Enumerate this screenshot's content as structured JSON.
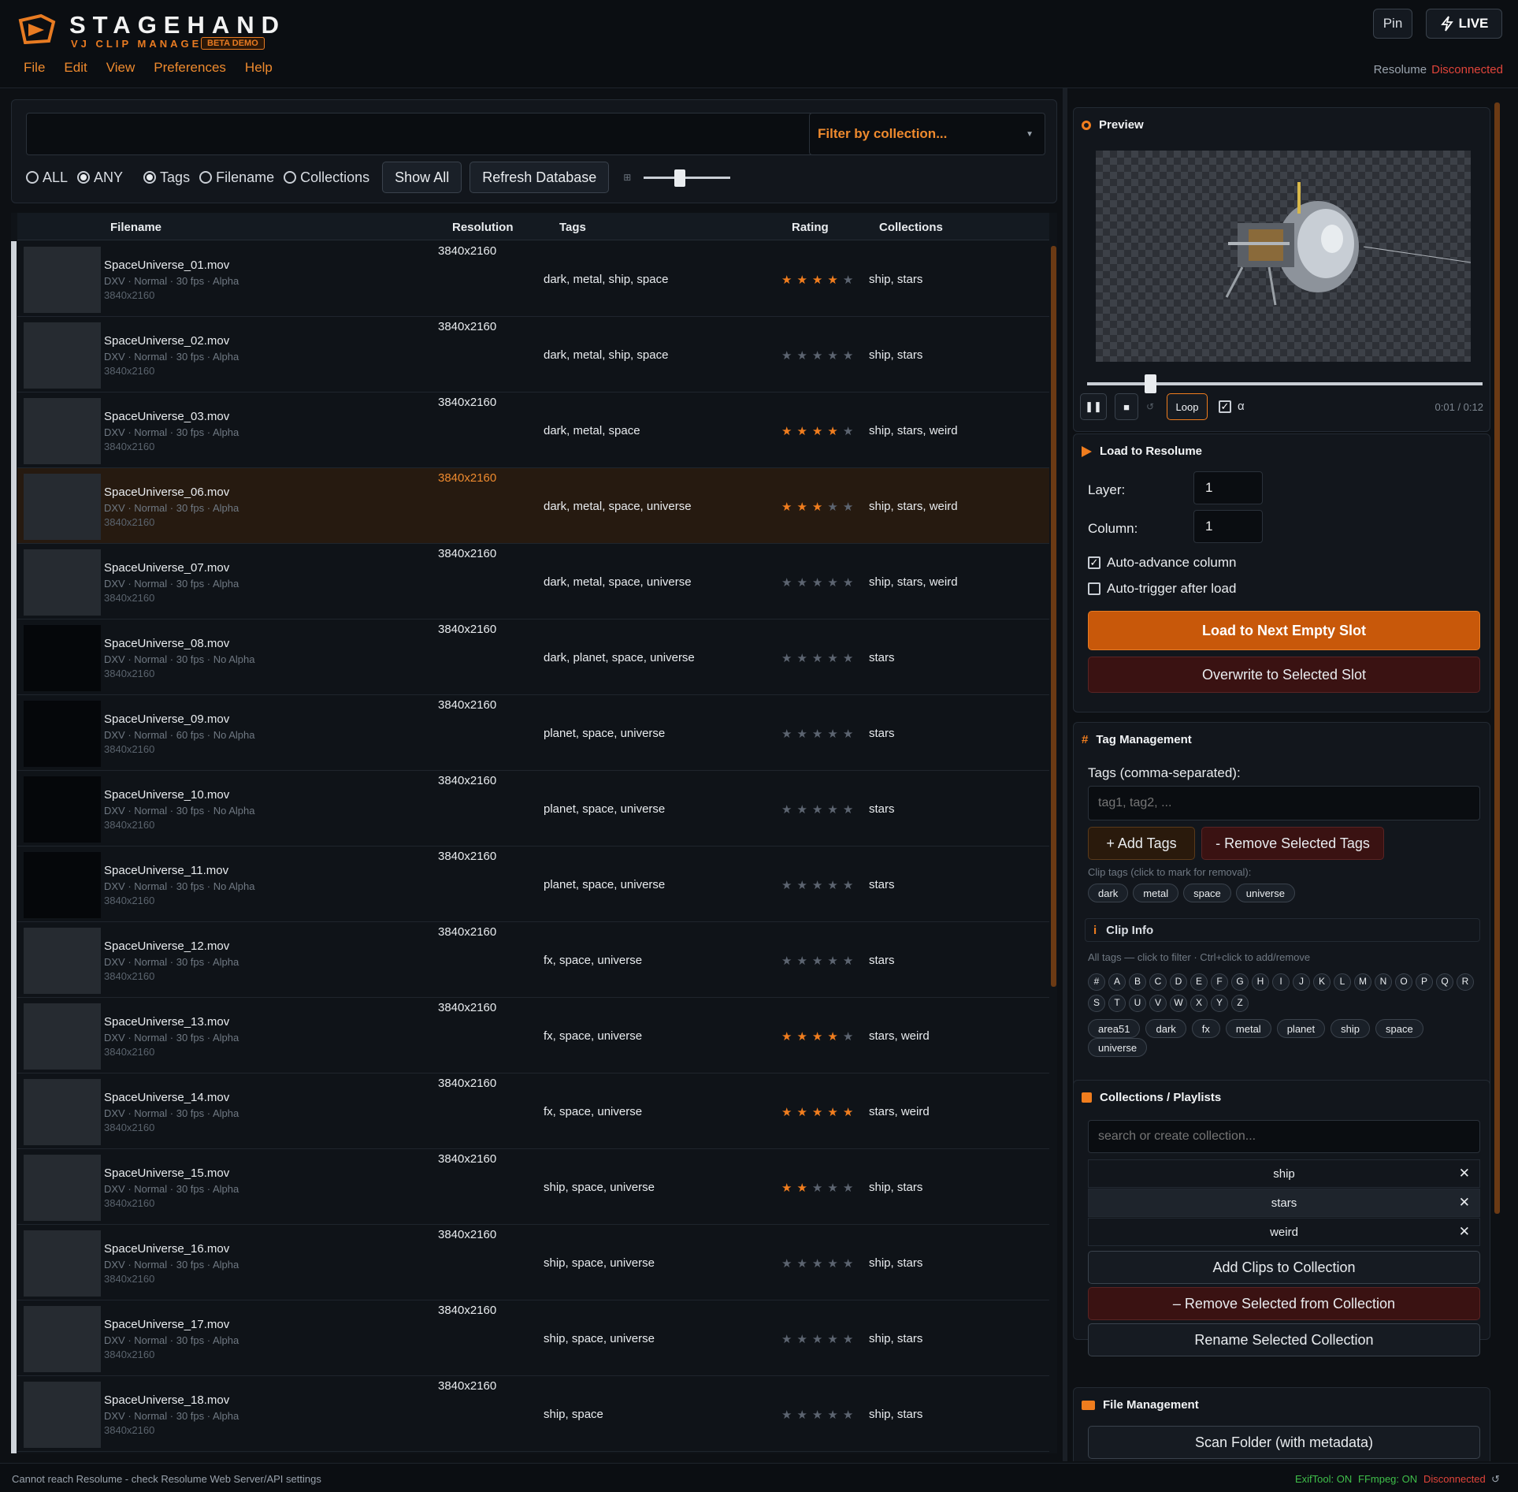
{
  "app": {
    "title": "STAGEHAND",
    "subtitle": "VJ CLIP MANAGER",
    "badge": "BETA DEMO"
  },
  "menu": [
    "File",
    "Edit",
    "View",
    "Preferences",
    "Help"
  ],
  "header": {
    "pin_label": "Pin",
    "live_label": "LIVE",
    "resolume_label": "Resolume",
    "resolume_status": "Disconnected",
    "status_color": "#e0443a"
  },
  "search": {
    "query": "",
    "collection_filter": "Filter by collection...",
    "match_options": [
      "ALL",
      "ANY"
    ],
    "match_selected": "ANY",
    "field_options": [
      "Tags",
      "Filename",
      "Collections"
    ],
    "field_selected": "Tags",
    "show_all_label": "Show All",
    "refresh_label": "Refresh Database",
    "thumb_size": 0.4
  },
  "table": {
    "columns": [
      "Filename",
      "Resolution",
      "Tags",
      "Rating",
      "Collections"
    ],
    "rows": [
      {
        "filename": "SpaceUniverse_01.mov",
        "meta": "DXV · Normal · 30 fps · Alpha",
        "res": "3840x2160",
        "tags": "dark, metal, ship, space",
        "rating": 4,
        "collections": "ship, stars",
        "dark": false
      },
      {
        "filename": "SpaceUniverse_02.mov",
        "meta": "DXV · Normal · 30 fps · Alpha",
        "res": "3840x2160",
        "tags": "dark, metal, ship, space",
        "rating": 0,
        "collections": "ship, stars",
        "dark": false
      },
      {
        "filename": "SpaceUniverse_03.mov",
        "meta": "DXV · Normal · 30 fps · Alpha",
        "res": "3840x2160",
        "tags": "dark, metal, space",
        "rating": 4,
        "collections": "ship, stars, weird",
        "dark": false
      },
      {
        "filename": "SpaceUniverse_06.mov",
        "meta": "DXV · Normal · 30 fps · Alpha",
        "res": "3840x2160",
        "tags": "dark, metal, space, universe",
        "rating": 3,
        "collections": "ship, stars, weird",
        "dark": false,
        "selected": true
      },
      {
        "filename": "SpaceUniverse_07.mov",
        "meta": "DXV · Normal · 30 fps · Alpha",
        "res": "3840x2160",
        "tags": "dark, metal, space, universe",
        "rating": 0,
        "collections": "ship, stars, weird",
        "dark": false
      },
      {
        "filename": "SpaceUniverse_08.mov",
        "meta": "DXV · Normal · 30 fps · No Alpha",
        "res": "3840x2160",
        "tags": "dark, planet, space, universe",
        "rating": 0,
        "collections": "stars",
        "dark": true
      },
      {
        "filename": "SpaceUniverse_09.mov",
        "meta": "DXV · Normal · 60 fps · No Alpha",
        "res": "3840x2160",
        "tags": "planet, space, universe",
        "rating": 0,
        "collections": "stars",
        "dark": true
      },
      {
        "filename": "SpaceUniverse_10.mov",
        "meta": "DXV · Normal · 30 fps · No Alpha",
        "res": "3840x2160",
        "tags": "planet, space, universe",
        "rating": 0,
        "collections": "stars",
        "dark": true
      },
      {
        "filename": "SpaceUniverse_11.mov",
        "meta": "DXV · Normal · 30 fps · No Alpha",
        "res": "3840x2160",
        "tags": "planet, space, universe",
        "rating": 0,
        "collections": "stars",
        "dark": true
      },
      {
        "filename": "SpaceUniverse_12.mov",
        "meta": "DXV · Normal · 30 fps · Alpha",
        "res": "3840x2160",
        "tags": "fx, space, universe",
        "rating": 0,
        "collections": "stars",
        "dark": false
      },
      {
        "filename": "SpaceUniverse_13.mov",
        "meta": "DXV · Normal · 30 fps · Alpha",
        "res": "3840x2160",
        "tags": "fx, space, universe",
        "rating": 4,
        "collections": "stars, weird",
        "dark": false
      },
      {
        "filename": "SpaceUniverse_14.mov",
        "meta": "DXV · Normal · 30 fps · Alpha",
        "res": "3840x2160",
        "tags": "fx, space, universe",
        "rating": 5,
        "collections": "stars, weird",
        "dark": false
      },
      {
        "filename": "SpaceUniverse_15.mov",
        "meta": "DXV · Normal · 30 fps · Alpha",
        "res": "3840x2160",
        "tags": "ship, space, universe",
        "rating": 2,
        "collections": "ship, stars",
        "dark": false
      },
      {
        "filename": "SpaceUniverse_16.mov",
        "meta": "DXV · Normal · 30 fps · Alpha",
        "res": "3840x2160",
        "tags": "ship, space, universe",
        "rating": 0,
        "collections": "ship, stars",
        "dark": false
      },
      {
        "filename": "SpaceUniverse_17.mov",
        "meta": "DXV · Normal · 30 fps · Alpha",
        "res": "3840x2160",
        "tags": "ship, space, universe",
        "rating": 0,
        "collections": "ship, stars",
        "dark": false
      },
      {
        "filename": "SpaceUniverse_18.mov",
        "meta": "DXV · Normal · 30 fps · Alpha",
        "res": "3840x2160",
        "tags": "ship, space",
        "rating": 0,
        "collections": "ship, stars",
        "dark": false
      }
    ]
  },
  "preview": {
    "title": "Preview",
    "loop_label": "Loop",
    "alpha_label": "α",
    "time": "0:01 / 0:12",
    "position": 0.15
  },
  "load": {
    "title": "Load to Resolume",
    "layer_label": "Layer:",
    "layer": "1",
    "column_label": "Column:",
    "column": "1",
    "auto_advance": "Auto-advance column",
    "auto_trigger": "Auto-trigger after load",
    "load_next": "Load to Next Empty Slot",
    "overwrite": "Overwrite to Selected Slot"
  },
  "tags": {
    "title": "Tag Management",
    "input_label": "Tags (comma-separated):",
    "placeholder": "tag1, tag2, ...",
    "add_label": "+ Add Tags",
    "remove_label": "- Remove Selected Tags",
    "clip_tags_note": "Clip tags (click to mark for removal):",
    "clip_tags": [
      "dark",
      "metal",
      "space",
      "universe"
    ]
  },
  "clip_info": {
    "title": "Clip Info",
    "note": "All tags — click to filter · Ctrl+click to add/remove",
    "letters": [
      "#",
      "A",
      "B",
      "C",
      "D",
      "E",
      "F",
      "G",
      "H",
      "I",
      "J",
      "K",
      "L",
      "M",
      "N",
      "O",
      "P",
      "Q",
      "R",
      "S",
      "T",
      "U",
      "V",
      "W",
      "X",
      "Y",
      "Z"
    ],
    "all_tags": [
      "area51",
      "dark",
      "fx",
      "metal",
      "planet",
      "ship",
      "space",
      "universe"
    ]
  },
  "collections": {
    "title": "Collections / Playlists",
    "placeholder": "search or create collection...",
    "items": [
      "ship",
      "stars",
      "weird"
    ],
    "add_label": "Add Clips to Collection",
    "remove_label": "– Remove Selected from Collection",
    "rename_label": "Rename Selected Collection"
  },
  "files": {
    "title": "File Management",
    "scan_label": "Scan Folder (with metadata)"
  },
  "footer": {
    "message": "Cannot reach Resolume - check Resolume Web Server/API settings",
    "exiftool": "ExifTool: ON",
    "ffmpeg": "FFmpeg: ON",
    "status": "Disconnected",
    "ok_color": "#3fbf4a",
    "err_color": "#e0443a"
  }
}
